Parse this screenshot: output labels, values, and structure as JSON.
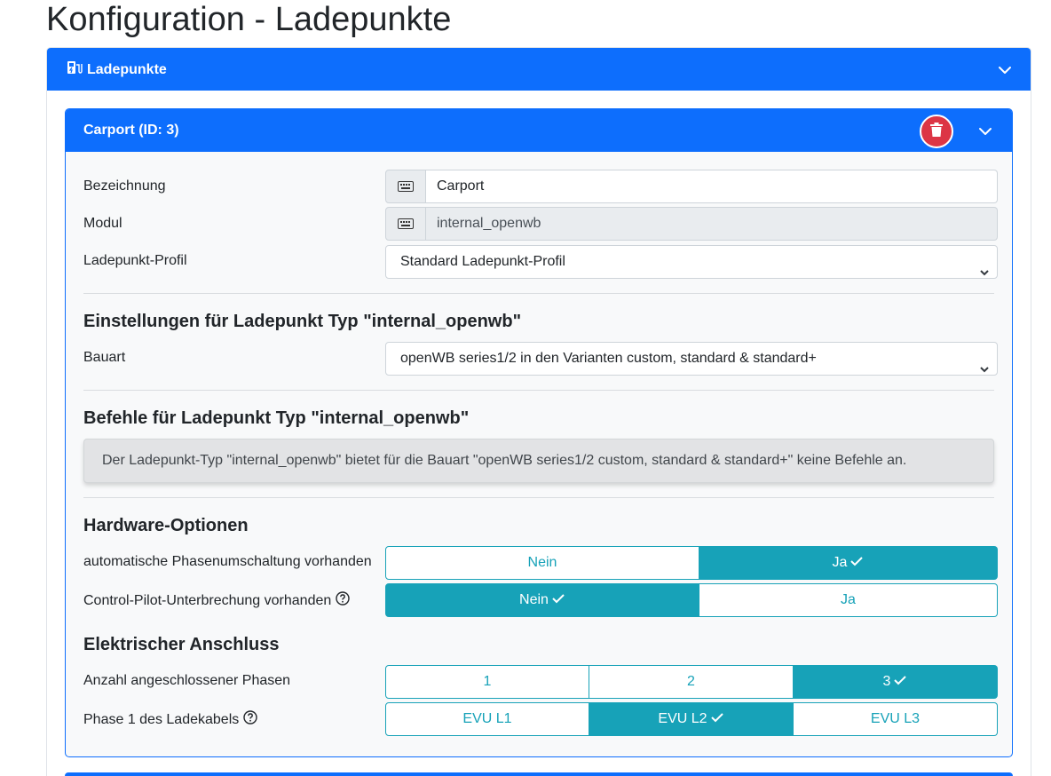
{
  "page": {
    "title": "Konfiguration - Ladepunkte"
  },
  "outer_card": {
    "title": "Ladepunkte",
    "icon": "charging-station-icon"
  },
  "chargepoint": {
    "title": "Carport (ID: 3)",
    "fields": {
      "name_label": "Bezeichnung",
      "name_value": "Carport",
      "module_label": "Modul",
      "module_value": "internal_openwb",
      "profile_label": "Ladepunkt-Profil",
      "profile_value": "Standard Ladepunkt-Profil"
    },
    "type_settings": {
      "heading": "Einstellungen für Ladepunkt Typ \"internal_openwb\"",
      "bauart_label": "Bauart",
      "bauart_value": "openWB series1/2 in den Varianten custom, standard & standard+"
    },
    "commands": {
      "heading": "Befehle für Ladepunkt Typ \"internal_openwb\"",
      "message": "Der Ladepunkt-Typ \"internal_openwb\" bietet für die Bauart \"openWB series1/2 custom, standard & standard+\" keine Befehle an."
    },
    "hardware": {
      "heading": "Hardware-Optionen",
      "phase_switch_label": "automatische Phasenumschaltung vorhanden",
      "phase_switch_options": [
        "Nein",
        "Ja"
      ],
      "phase_switch_selected": "Ja",
      "cp_interrupt_label": "Control-Pilot-Unterbrechung vorhanden",
      "cp_interrupt_options": [
        "Nein",
        "Ja"
      ],
      "cp_interrupt_selected": "Nein"
    },
    "electrical": {
      "heading": "Elektrischer Anschluss",
      "phases_label": "Anzahl angeschlossener Phasen",
      "phases_options": [
        "1",
        "2",
        "3"
      ],
      "phases_selected": "3",
      "phase1_label": "Phase 1 des Ladekabels",
      "phase1_options": [
        "EVU L1",
        "EVU L2",
        "EVU L3"
      ],
      "phase1_selected": "EVU L2"
    }
  },
  "colors": {
    "primary": "#0d6efd",
    "info": "#17a2b8",
    "danger": "#dc3545",
    "alert_bg": "#e2e3e5"
  }
}
